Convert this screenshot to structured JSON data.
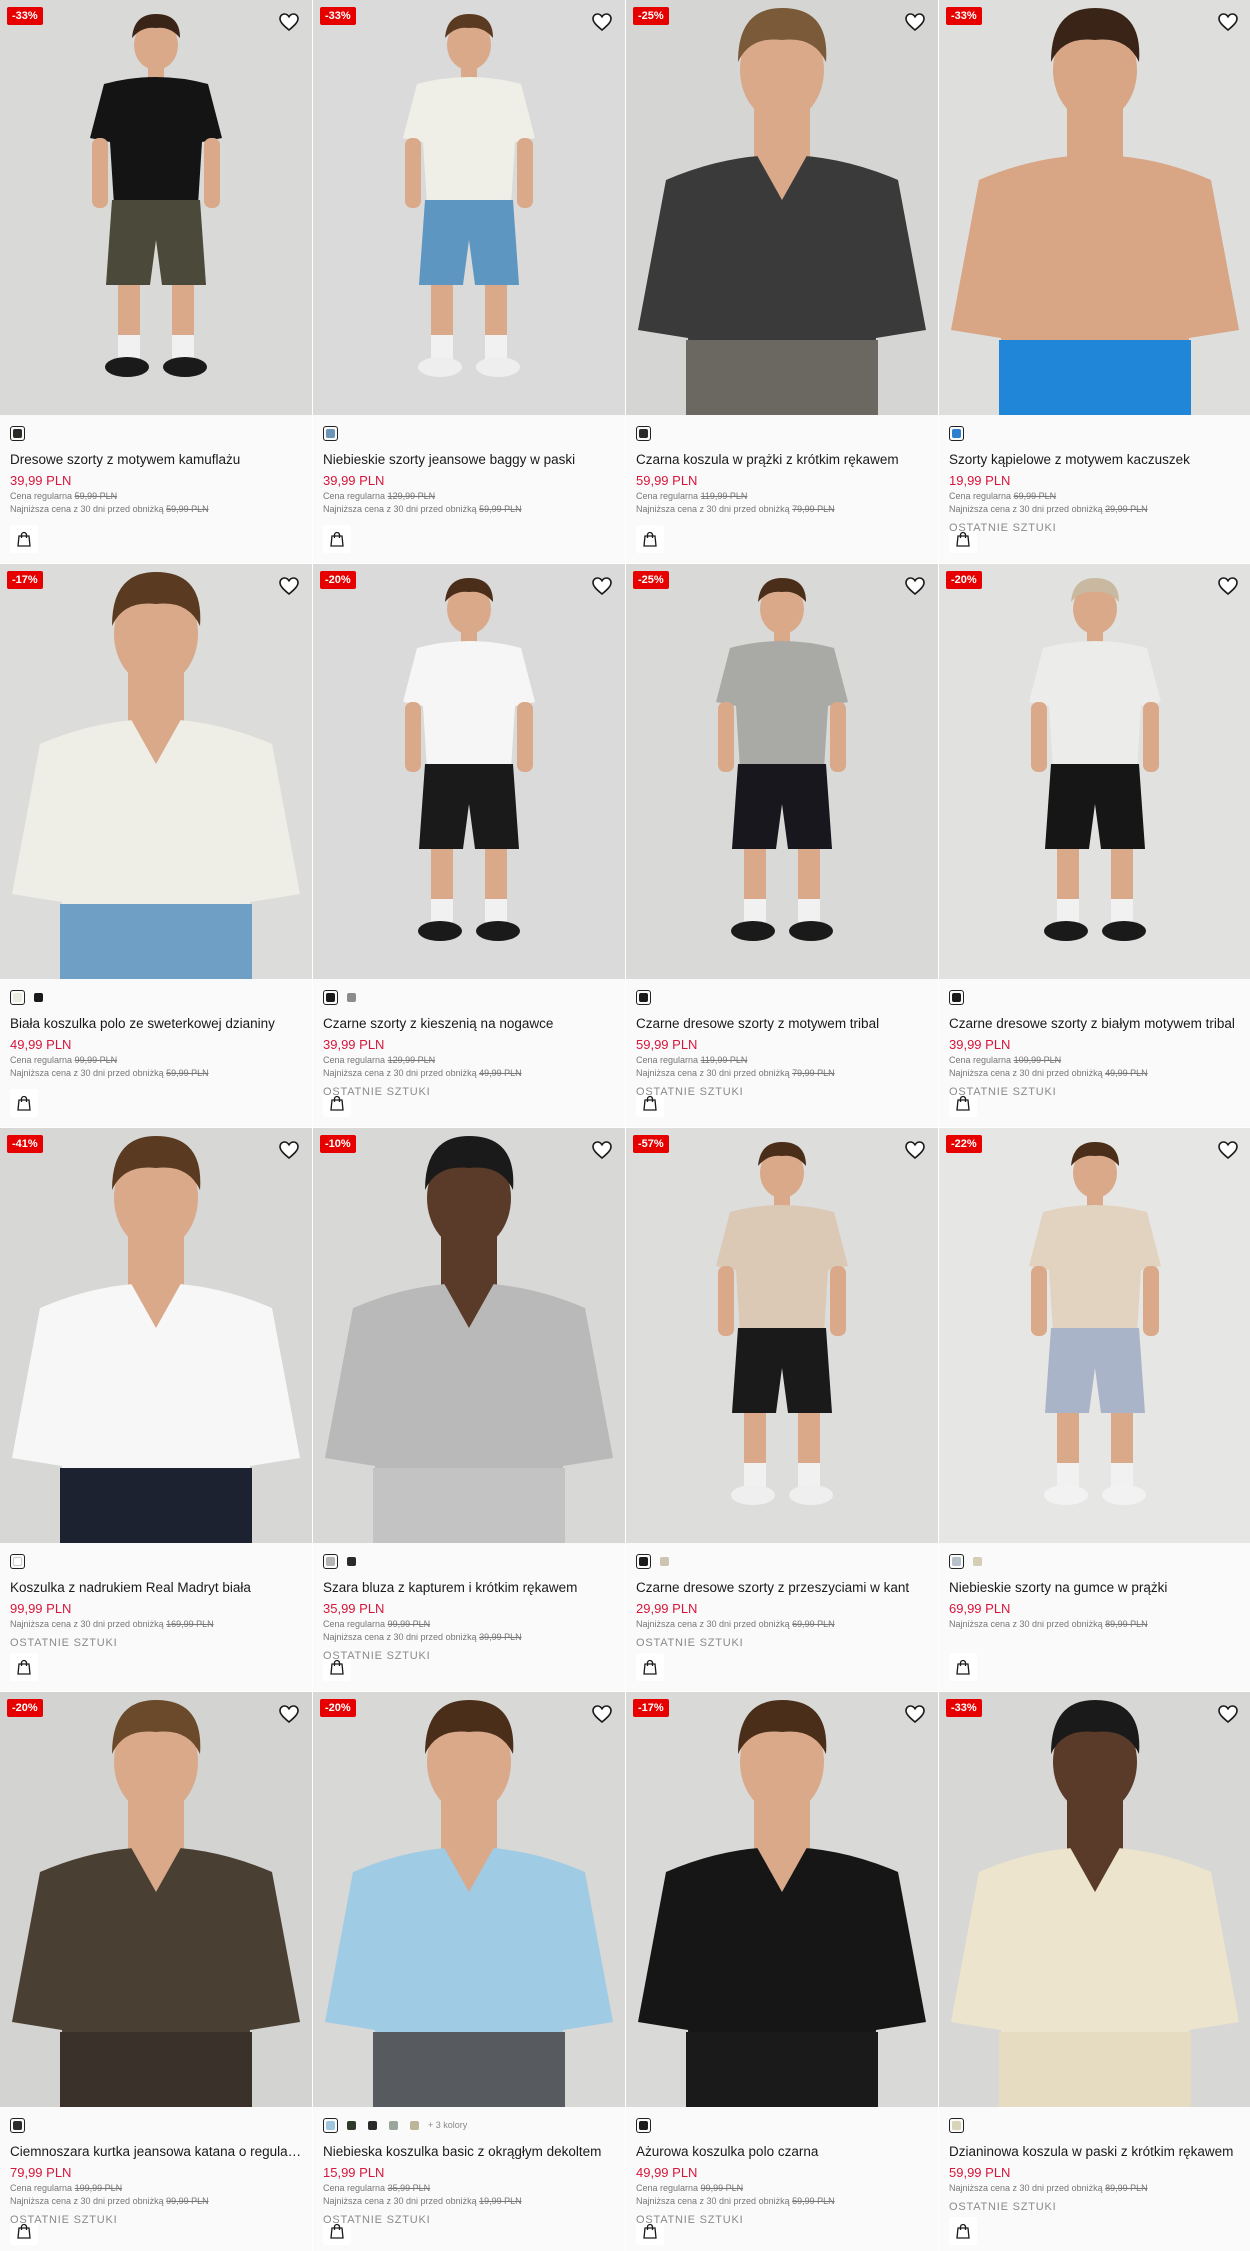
{
  "colors": {
    "discount": "#e60000",
    "price": "#d6163b",
    "background": "#f0f0f0"
  },
  "labels": {
    "regular_prefix": "Cena regularna",
    "lowest_prefix": "Najniższa cena z 30 dni przed obniżką"
  },
  "products": [
    {
      "discount": "-33%",
      "name": "Dresowe szorty z motywem kamuflażu",
      "price": "39,99 PLN",
      "regular": "59,99 PLN",
      "lowest": "59,99 PLN",
      "stock": "",
      "swatches": [
        "#2b2a25"
      ],
      "more": "",
      "photo": {
        "bg": "#d9dad8",
        "top": "#141414",
        "bottom": "#4b4a3a",
        "skin": "#d9a98a",
        "hair": "#3a2417",
        "pose": "tee",
        "long_bottom": false,
        "shoes": "#1a1a1a"
      }
    },
    {
      "discount": "-33%",
      "name": "Niebieskie szorty jeansowe baggy w paski",
      "price": "39,99 PLN",
      "regular": "129,99 PLN",
      "lowest": "59,99 PLN",
      "stock": "",
      "swatches": [
        "#6d95b8"
      ],
      "more": "",
      "photo": {
        "bg": "#dadada",
        "top": "#efeee7",
        "bottom": "#5e96c2",
        "skin": "#d9a98a",
        "hair": "#5a3a20",
        "pose": "tee",
        "long_bottom": false,
        "shoes": "#eeeeee"
      }
    },
    {
      "discount": "-25%",
      "name": "Czarna koszula w prążki z krótkim rękawem",
      "price": "59,99 PLN",
      "regular": "119,99 PLN",
      "lowest": "79,99 PLN",
      "stock": "",
      "swatches": [
        "#2a2a2a"
      ],
      "more": "",
      "photo": {
        "bg": "#d5d5d3",
        "top": "#3a3a3a",
        "bottom": "#6b6761",
        "skin": "#d9a98a",
        "hair": "#7a5a38",
        "pose": "close",
        "long_bottom": false,
        "shoes": "#333"
      }
    },
    {
      "discount": "-33%",
      "name": "Szorty kąpielowe z motywem kaczuszek",
      "price": "19,99 PLN",
      "regular": "69,99 PLN",
      "lowest": "29,99 PLN",
      "stock": "OSTATNIE SZTUKI",
      "swatches": [
        "#2f7fd0"
      ],
      "more": "",
      "photo": {
        "bg": "#dededd",
        "top": "skin",
        "bottom": "#1f86d8",
        "skin": "#d8a585",
        "hair": "#3a2417",
        "pose": "close",
        "long_bottom": false,
        "shoes": "#333"
      }
    },
    {
      "discount": "-17%",
      "name": "Biała koszulka polo ze sweterkowej dzianiny",
      "price": "49,99 PLN",
      "regular": "99,99 PLN",
      "lowest": "59,99 PLN",
      "stock": "",
      "swatches": [
        "#ecebe2",
        "#1a1a1a"
      ],
      "more": "",
      "photo": {
        "bg": "#dcdcda",
        "top": "#efeee6",
        "bottom": "#6f9fc4",
        "skin": "#d9a98a",
        "hair": "#5a3a20",
        "pose": "close",
        "long_bottom": false,
        "shoes": "#333"
      }
    },
    {
      "discount": "-20%",
      "name": "Czarne szorty z kieszenią na nogawce",
      "price": "39,99 PLN",
      "regular": "129,99 PLN",
      "lowest": "49,99 PLN",
      "stock": "OSTATNIE SZTUKI",
      "swatches": [
        "#1a1a1a",
        "#8c8c8c"
      ],
      "more": "",
      "photo": {
        "bg": "#dadada",
        "top": "#f6f6f6",
        "bottom": "#1a1a1a",
        "skin": "#d9a98a",
        "hair": "#4a2e1a",
        "pose": "tee",
        "long_bottom": false,
        "shoes": "#1a1a1a"
      }
    },
    {
      "discount": "-25%",
      "name": "Czarne dresowe szorty z motywem tribal",
      "price": "59,99 PLN",
      "regular": "119,99 PLN",
      "lowest": "79,99 PLN",
      "stock": "OSTATNIE SZTUKI",
      "swatches": [
        "#1a1a1a"
      ],
      "more": "",
      "photo": {
        "bg": "#d9d9d7",
        "top": "#a9a9a6",
        "bottom": "#17171d",
        "skin": "#d9a98a",
        "hair": "#4a2e1a",
        "pose": "tee",
        "long_bottom": false,
        "shoes": "#1a1a1a"
      }
    },
    {
      "discount": "-20%",
      "name": "Czarne dresowe szorty z białym motywem tribal",
      "price": "39,99 PLN",
      "regular": "109,99 PLN",
      "lowest": "49,99 PLN",
      "stock": "OSTATNIE SZTUKI",
      "swatches": [
        "#1a1a1a"
      ],
      "more": "",
      "photo": {
        "bg": "#e1e1df",
        "top": "#ececea",
        "bottom": "#161616",
        "skin": "#d9a98a",
        "hair": "#c9b9a0",
        "pose": "tee",
        "long_bottom": false,
        "shoes": "#1a1a1a"
      }
    },
    {
      "discount": "-41%",
      "name": "Koszulka z nadrukiem Real Madryt biała",
      "price": "99,99 PLN",
      "regular": "",
      "lowest": "169,99 PLN",
      "stock": "OSTATNIE SZTUKI",
      "swatches": [
        "#ffffff"
      ],
      "more": "",
      "photo": {
        "bg": "#d7d8d6",
        "top": "#f7f7f7",
        "bottom": "#1c2230",
        "skin": "#d9a98a",
        "hair": "#5a3a20",
        "pose": "close",
        "long_bottom": false,
        "shoes": "#333"
      }
    },
    {
      "discount": "-10%",
      "name": "Szara bluza z kapturem i krótkim rękawem",
      "price": "35,99 PLN",
      "regular": "99,99 PLN",
      "lowest": "39,99 PLN",
      "stock": "OSTATNIE SZTUKI",
      "swatches": [
        "#b4b4b4",
        "#2a2a2a"
      ],
      "more": "",
      "photo": {
        "bg": "#d8d8d6",
        "top": "#b9b9b9",
        "bottom": "#c3c3c3",
        "skin": "#5a3a28",
        "hair": "#1a1a1a",
        "pose": "close",
        "long_bottom": false,
        "shoes": "#333"
      }
    },
    {
      "discount": "-57%",
      "name": "Czarne dresowe szorty z przeszyciami w kant",
      "price": "29,99 PLN",
      "regular": "",
      "lowest": "69,99 PLN",
      "stock": "OSTATNIE SZTUKI",
      "swatches": [
        "#1a1a1a",
        "#cdc5b2"
      ],
      "more": "",
      "photo": {
        "bg": "#dddddb",
        "top": "#dbc9b5",
        "bottom": "#1a1a1a",
        "skin": "#d9a98a",
        "hair": "#4a2e1a",
        "pose": "tee",
        "long_bottom": false,
        "shoes": "#efefef"
      }
    },
    {
      "discount": "-22%",
      "name": "Niebieskie szorty na gumce w prążki",
      "price": "69,99 PLN",
      "regular": "",
      "lowest": "89,99 PLN",
      "stock": "",
      "swatches": [
        "#b8c0cc",
        "#d3ceb4"
      ],
      "more": "",
      "photo": {
        "bg": "#e6e6e4",
        "top": "#e2d3c0",
        "bottom": "#aab4c8",
        "skin": "#d9a98a",
        "hair": "#4a2e1a",
        "pose": "tee",
        "long_bottom": false,
        "shoes": "#f2f2f2"
      }
    },
    {
      "discount": "-20%",
      "name": "Ciemnoszara kurtka jeansowa katana o regularnym kroju",
      "price": "79,99 PLN",
      "regular": "199,99 PLN",
      "lowest": "99,99 PLN",
      "stock": "OSTATNIE SZTUKI",
      "swatches": [
        "#2b2b2b"
      ],
      "more": "",
      "photo": {
        "bg": "#d3d3d1",
        "top": "#4a3f33",
        "bottom": "#3a322a",
        "skin": "#d9a98a",
        "hair": "#6a4a2a",
        "pose": "close",
        "long_bottom": false,
        "shoes": "#333"
      }
    },
    {
      "discount": "-20%",
      "name": "Niebieska koszulka basic z okrągłym dekoltem",
      "price": "15,99 PLN",
      "regular": "35,99 PLN",
      "lowest": "19,99 PLN",
      "stock": "OSTATNIE SZTUKI",
      "swatches": [
        "#9fc6dc",
        "#2f3b2a",
        "#2b2b2b",
        "#9aa69c",
        "#bdb59a"
      ],
      "more": "+ 3 kolory",
      "photo": {
        "bg": "#d8d8d6",
        "top": "#9fcbe4",
        "bottom": "#575a5e",
        "skin": "#d9a98a",
        "hair": "#4a2e1a",
        "pose": "close",
        "long_bottom": false,
        "shoes": "#333"
      }
    },
    {
      "discount": "-17%",
      "name": "Ażurowa koszulka polo czarna",
      "price": "49,99 PLN",
      "regular": "99,99 PLN",
      "lowest": "59,99 PLN",
      "stock": "OSTATNIE SZTUKI",
      "swatches": [
        "#1a1a1a"
      ],
      "more": "",
      "photo": {
        "bg": "#d9d9d7",
        "top": "#161616",
        "bottom": "#1a1a1a",
        "skin": "#d9a98a",
        "hair": "#4a2e1a",
        "pose": "close",
        "long_bottom": false,
        "shoes": "#333"
      }
    },
    {
      "discount": "-33%",
      "name": "Dzianinowa koszula w paski z krótkim rękawem",
      "price": "59,99 PLN",
      "regular": "",
      "lowest": "89,99 PLN",
      "stock": "OSTATNIE SZTUKI",
      "swatches": [
        "#d8d4b8"
      ],
      "more": "",
      "photo": {
        "bg": "#d7d7d5",
        "top": "#ece4cc",
        "bottom": "#e6dcc2",
        "skin": "#5a3a28",
        "hair": "#1a1a1a",
        "pose": "close",
        "long_bottom": false,
        "shoes": "#333"
      }
    }
  ]
}
